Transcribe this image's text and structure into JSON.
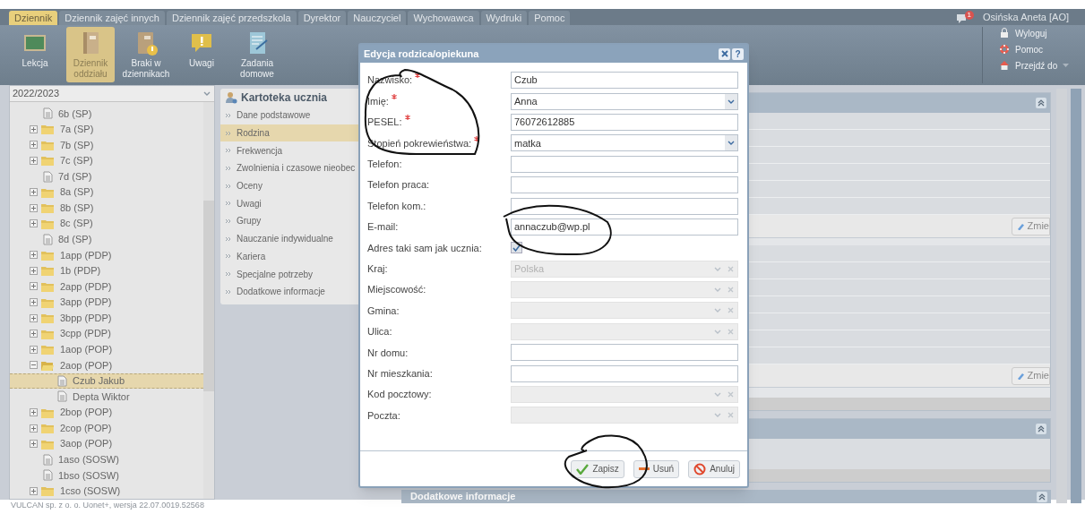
{
  "tabs": [
    {
      "label": "Dziennik",
      "selected": true
    },
    {
      "label": "Dziennik zajęć innych",
      "selected": false
    },
    {
      "label": "Dziennik zajęć przedszkola",
      "selected": false
    },
    {
      "label": "Dyrektor",
      "selected": false
    },
    {
      "label": "Nauczyciel",
      "selected": false
    },
    {
      "label": "Wychowawca",
      "selected": false
    },
    {
      "label": "Wydruki",
      "selected": false
    },
    {
      "label": "Pomoc",
      "selected": false
    }
  ],
  "user": {
    "notifications": "1",
    "name": "Osińska Aneta [AO]"
  },
  "toolbar": [
    {
      "kind": "board",
      "label": "Lekcja",
      "selected": false
    },
    {
      "kind": "book",
      "label": "Dziennik oddziału",
      "selected": true
    },
    {
      "kind": "book-alert",
      "label": "Braki w dziennikach",
      "selected": false
    },
    {
      "kind": "note",
      "label": "Uwagi",
      "selected": false
    },
    {
      "kind": "notebook",
      "label": "Zadania domowe",
      "selected": false
    }
  ],
  "user_menu": [
    {
      "kind": "lock",
      "label": "Wyloguj"
    },
    {
      "kind": "help",
      "label": "Pomoc"
    },
    {
      "kind": "home",
      "label": "Przejdź do",
      "dropdown": true
    }
  ],
  "year_select": {
    "value": "2022/2023"
  },
  "tree": [
    {
      "kind": "file",
      "label": "6b (SP)",
      "selected": false
    },
    {
      "kind": "folder",
      "label": "7a (SP)",
      "expanded": false,
      "selected": false
    },
    {
      "kind": "folder",
      "label": "7b (SP)",
      "expanded": false,
      "selected": false
    },
    {
      "kind": "folder",
      "label": "7c (SP)",
      "expanded": false,
      "selected": false
    },
    {
      "kind": "file",
      "label": "7d (SP)",
      "selected": false
    },
    {
      "kind": "folder",
      "label": "8a (SP)",
      "expanded": false,
      "selected": false
    },
    {
      "kind": "folder",
      "label": "8b (SP)",
      "expanded": false,
      "selected": false
    },
    {
      "kind": "folder",
      "label": "8c (SP)",
      "expanded": false,
      "selected": false
    },
    {
      "kind": "file",
      "label": "8d (SP)",
      "selected": false
    },
    {
      "kind": "folder",
      "label": "1app (PDP)",
      "expanded": false,
      "selected": false
    },
    {
      "kind": "folder",
      "label": "1b (PDP)",
      "expanded": false,
      "selected": false
    },
    {
      "kind": "folder",
      "label": "2app (PDP)",
      "expanded": false,
      "selected": false
    },
    {
      "kind": "folder",
      "label": "3app (PDP)",
      "expanded": false,
      "selected": false
    },
    {
      "kind": "folder",
      "label": "3bpp (PDP)",
      "expanded": false,
      "selected": false
    },
    {
      "kind": "folder",
      "label": "3cpp (PDP)",
      "expanded": false,
      "selected": false
    },
    {
      "kind": "folder",
      "label": "1aop (POP)",
      "expanded": false,
      "selected": false
    },
    {
      "kind": "folder",
      "label": "2aop (POP)",
      "expanded": true,
      "selected": false,
      "children": [
        {
          "kind": "file",
          "label": "Czub Jakub",
          "selected": true
        },
        {
          "kind": "file",
          "label": "Depta Wiktor",
          "selected": false
        }
      ]
    },
    {
      "kind": "folder",
      "label": "2bop (POP)",
      "expanded": false,
      "selected": false
    },
    {
      "kind": "folder",
      "label": "2cop (POP)",
      "expanded": false,
      "selected": false
    },
    {
      "kind": "folder",
      "label": "3aop (POP)",
      "expanded": false,
      "selected": false
    },
    {
      "kind": "file",
      "label": "1aso (SOSW)",
      "selected": false
    },
    {
      "kind": "file",
      "label": "1bso (SOSW)",
      "selected": false
    },
    {
      "kind": "folder",
      "label": "1cso (SOSW)",
      "expanded": false,
      "selected": false
    }
  ],
  "student_card": {
    "title": "Kartoteka ucznia",
    "items": [
      {
        "label": "Dane podstawowe",
        "selected": false
      },
      {
        "label": "Rodzina",
        "selected": true
      },
      {
        "label": "Frekwencja",
        "selected": false
      },
      {
        "label": "Zwolnienia i czasowe nieobec",
        "selected": false
      },
      {
        "label": "Oceny",
        "selected": false
      },
      {
        "label": "Uwagi",
        "selected": false
      },
      {
        "label": "Grupy",
        "selected": false
      },
      {
        "label": "Nauczanie indywidualne",
        "selected": false
      },
      {
        "label": "Kariera",
        "selected": false
      },
      {
        "label": "Specjalne potrzeby",
        "selected": false
      },
      {
        "label": "Dodatkowe informacje",
        "selected": false
      }
    ]
  },
  "right_panels": [
    {
      "button": "Zmie"
    },
    {
      "button": "Zmie"
    }
  ],
  "bottom_panel": {
    "title": "Dodatkowe informacje"
  },
  "dialog": {
    "title": "Edycja rodzica/opiekuna",
    "help_button": "?",
    "fields": [
      {
        "kind": "text",
        "label": "Nazwisko:",
        "required": true,
        "disabled": false,
        "value": "Czub"
      },
      {
        "kind": "select",
        "label": "Imię:",
        "required": true,
        "disabled": false,
        "value": "Anna"
      },
      {
        "kind": "text",
        "label": "PESEL:",
        "required": true,
        "disabled": false,
        "value": "76072612885"
      },
      {
        "kind": "select",
        "label": "Stopień pokrewieństwa:",
        "required": true,
        "disabled": false,
        "value": "matka"
      },
      {
        "kind": "text",
        "label": "Telefon:",
        "required": false,
        "disabled": false
      },
      {
        "kind": "text",
        "label": "Telefon praca:",
        "required": false,
        "disabled": false
      },
      {
        "kind": "text",
        "label": "Telefon kom.:",
        "required": false,
        "disabled": false
      },
      {
        "kind": "text",
        "label": "E-mail:",
        "required": false,
        "disabled": false,
        "value": "annaczub@wp.pl"
      },
      {
        "kind": "checkbox",
        "label": "Adres taki sam jak ucznia:",
        "required": false,
        "disabled": false,
        "checked": true
      },
      {
        "kind": "combo",
        "label": "Kraj:",
        "required": false,
        "disabled": true,
        "value": "Polska"
      },
      {
        "kind": "combo",
        "label": "Miejscowość:",
        "required": false,
        "disabled": true
      },
      {
        "kind": "combo",
        "label": "Gmina:",
        "required": false,
        "disabled": true
      },
      {
        "kind": "combo",
        "label": "Ulica:",
        "required": false,
        "disabled": true
      },
      {
        "kind": "text",
        "label": "Nr domu:",
        "required": false,
        "disabled": false
      },
      {
        "kind": "text",
        "label": "Nr mieszkania:",
        "required": false,
        "disabled": false
      },
      {
        "kind": "combo",
        "label": "Kod pocztowy:",
        "required": false,
        "disabled": true
      },
      {
        "kind": "combo",
        "label": "Poczta:",
        "required": false,
        "disabled": true
      }
    ],
    "buttons": [
      {
        "kind": "save",
        "label": "Zapisz"
      },
      {
        "kind": "delete",
        "label": "Usuń"
      },
      {
        "kind": "cancel",
        "label": "Anuluj"
      }
    ]
  },
  "footer": "VULCAN sp. z o. o. Uonet+, wersja 22.07.0019.52568"
}
